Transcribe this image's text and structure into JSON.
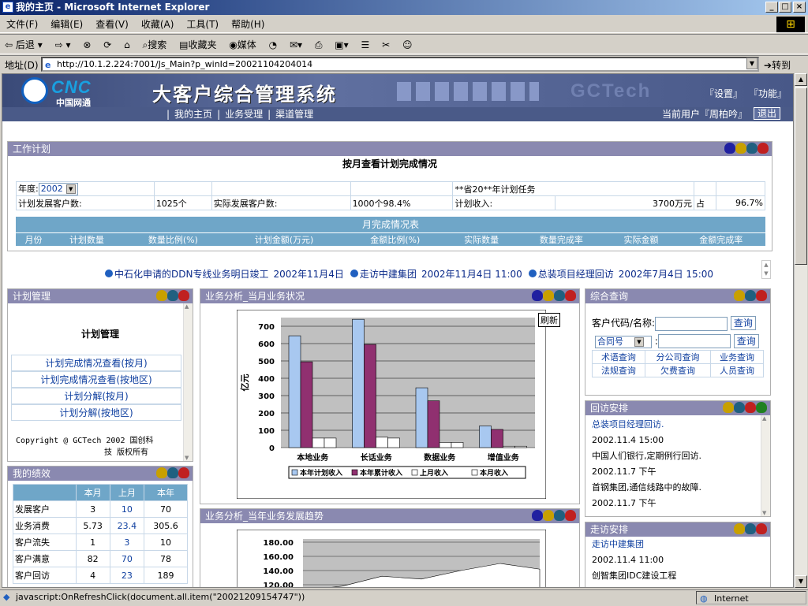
{
  "window": {
    "title": "我的主页 - Microsoft Internet Explorer"
  },
  "menu": [
    "文件(F)",
    "编辑(E)",
    "查看(V)",
    "收藏(A)",
    "工具(T)",
    "帮助(H)"
  ],
  "toolbar": {
    "back": "后退",
    "search": "搜索",
    "favorites": "收藏夹",
    "media": "媒体"
  },
  "address": {
    "label": "地址(D)",
    "url": "http://10.1.2.224:7001/Js_Main?p_winId=20021104204014",
    "go": "转到"
  },
  "status": {
    "text": "javascript:OnRefreshClick(document.all.item(\"20021209154747\"))",
    "zone": "Internet"
  },
  "banner": {
    "logo_text": "CNC",
    "logo_sub": "中国网通",
    "system_title": "大客户综合管理系统",
    "brand": "GCTech",
    "settings": "『设置』",
    "functions": "『功能』"
  },
  "nav": {
    "home": "我的主页",
    "business": "业务受理",
    "channel": "渠道管理",
    "current_user": "当前用户『周柏吟』",
    "logout": "退出"
  },
  "work_plan": {
    "header": "工作计划",
    "title": "按月查看计划完成情况",
    "year_label": "年度:",
    "year_value": "2002",
    "plan_task": "**省20**年计划任务",
    "plan_customers_label": "计划发展客户数:",
    "plan_customers": "1025个",
    "actual_customers_label": "实际发展客户数:",
    "actual_customers": "1000个98.4%",
    "plan_income_label": "计划收入:",
    "plan_income": "3700万元",
    "share_label": "占",
    "share_value": "96.7%",
    "month_table_title": "月完成情况表",
    "columns": [
      "月份",
      "计划数量",
      "数量比例(%)",
      "计划金额(万元)",
      "金额比例(%)",
      "实际数量",
      "数量完成率",
      "实际金额",
      "金额完成率"
    ]
  },
  "news": [
    {
      "text": "中石化申请的DDN专线业务明日竣工",
      "date": "2002年11月4日"
    },
    {
      "text": "走访中建集团",
      "date": "2002年11月4日 11:00"
    },
    {
      "text": "总装项目经理回访",
      "date": "2002年7月4日 15:00"
    }
  ],
  "plan_mgmt": {
    "header": "计划管理",
    "title": "计划管理",
    "links": [
      "计划完成情况查看(按月)",
      "计划完成情况查看(按地区)",
      "计划分解(按月)",
      "计划分解(按地区)"
    ],
    "copyright1": "Copyright @ GCTech 2002 国创科",
    "copyright2": "技 版权所有"
  },
  "performance": {
    "header": "我的绩效",
    "columns": [
      "",
      "本月",
      "上月",
      "本年"
    ],
    "rows": [
      {
        "label": "发展客户",
        "m": "3",
        "lm": "10",
        "y": "70"
      },
      {
        "label": "业务消费",
        "m": "5.73",
        "lm": "23.4",
        "y": "305.6"
      },
      {
        "label": "客户流失",
        "m": "1",
        "lm": "3",
        "y": "10"
      },
      {
        "label": "客户满意",
        "m": "82",
        "lm": "70",
        "y": "78"
      },
      {
        "label": "客户回访",
        "m": "4",
        "lm": "23",
        "y": "189"
      }
    ]
  },
  "analysis_month": {
    "header": "业务分析_当月业务状况",
    "refresh": "刷新"
  },
  "analysis_year": {
    "header": "业务分析_当年业务发展趋势"
  },
  "query": {
    "header": "综合查询",
    "customer_label": "客户代码/名称:",
    "query_btn": "查询",
    "contract_select": "合同号",
    "colon": ":",
    "grid": [
      [
        "术语查询",
        "分公司查询",
        "业务查询"
      ],
      [
        "法规查询",
        "欠费查询",
        "人员查询"
      ]
    ]
  },
  "revisit": {
    "header": "回访安排",
    "items": [
      {
        "text": "总装项目经理回访.",
        "link": true
      },
      {
        "text": "2002.11.4  15:00",
        "link": false
      },
      {
        "text": "中国人们银行,定期例行回访.",
        "link": false
      },
      {
        "text": "2002.11.7  下午",
        "link": false
      },
      {
        "text": "首钢集团,通信线路中的故障.",
        "link": false
      },
      {
        "text": "2002.11.7  下午",
        "link": false
      }
    ]
  },
  "visit": {
    "header": "走访安排",
    "items": [
      {
        "text": "走访中建集团",
        "link": true
      },
      {
        "text": "2002.11.4  11:00",
        "link": false
      },
      {
        "text": "创智集团IDC建设工程",
        "link": false
      }
    ]
  },
  "colors": {
    "panel_header": "#8a89b0",
    "table_header": "#6fa6c8",
    "link": "#1040a0"
  },
  "chart_data": [
    {
      "type": "bar",
      "title": "",
      "ylabel": "亿元",
      "ylim": [
        0,
        750
      ],
      "yticks": [
        0,
        100,
        200,
        300,
        400,
        500,
        600,
        700
      ],
      "categories": [
        "本地业务",
        "长话业务",
        "数据业务",
        "增值业务"
      ],
      "series": [
        {
          "name": "本年计划收入",
          "color": "#a8c8f0",
          "values": [
            645,
            740,
            345,
            125
          ]
        },
        {
          "name": "本年累计收入",
          "color": "#903070",
          "values": [
            495,
            595,
            270,
            105
          ]
        },
        {
          "name": "上月收入",
          "color": "#ffffff",
          "values": [
            55,
            60,
            30,
            8
          ]
        },
        {
          "name": "本月收入",
          "color": "#ffffff",
          "values": [
            55,
            55,
            30,
            8
          ]
        }
      ]
    },
    {
      "type": "area",
      "title": "",
      "yticks_visible": [
        "180.00",
        "160.00",
        "140.00",
        "120.00"
      ],
      "values": [
        112,
        118,
        132,
        128,
        140,
        150,
        142
      ]
    }
  ]
}
